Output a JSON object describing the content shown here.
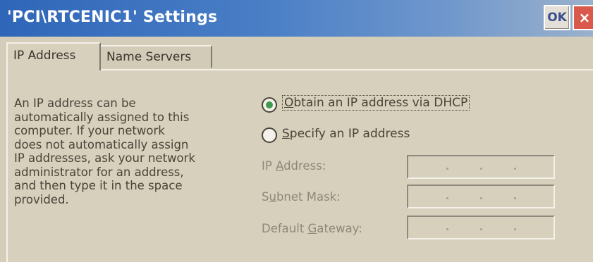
{
  "window": {
    "title": "'PCI\\RTCENIC1' Settings",
    "ok_label": "OK",
    "close_label": "×"
  },
  "tabs": [
    {
      "label": "IP Address",
      "active": true
    },
    {
      "label": "Name Servers",
      "active": false
    }
  ],
  "description_lines": [
    "An IP address can be",
    "automatically assigned to this",
    "computer.  If your network",
    "does not automatically assign",
    "IP addresses, ask your network",
    "administrator for an address,",
    "and then type it in the space",
    "provided."
  ],
  "options": {
    "dhcp": {
      "mnemonic": "O",
      "rest": "btain an IP address via DHCP",
      "selected": true
    },
    "specify": {
      "mnemonic": "S",
      "rest": "pecify an IP address",
      "selected": false
    }
  },
  "fields": {
    "ip_address": {
      "pre": "IP ",
      "mnemonic": "A",
      "post": "ddress:",
      "value": ""
    },
    "subnet_mask": {
      "pre": "S",
      "mnemonic": "u",
      "post": "bnet Mask:",
      "value": ""
    },
    "default_gateway": {
      "pre": "Default ",
      "mnemonic": "G",
      "post": "ateway:",
      "value": ""
    }
  },
  "colors": {
    "title_bar": "#2f66b8",
    "radio_selected": "#3f9b4f",
    "close_button": "#d9594d"
  }
}
